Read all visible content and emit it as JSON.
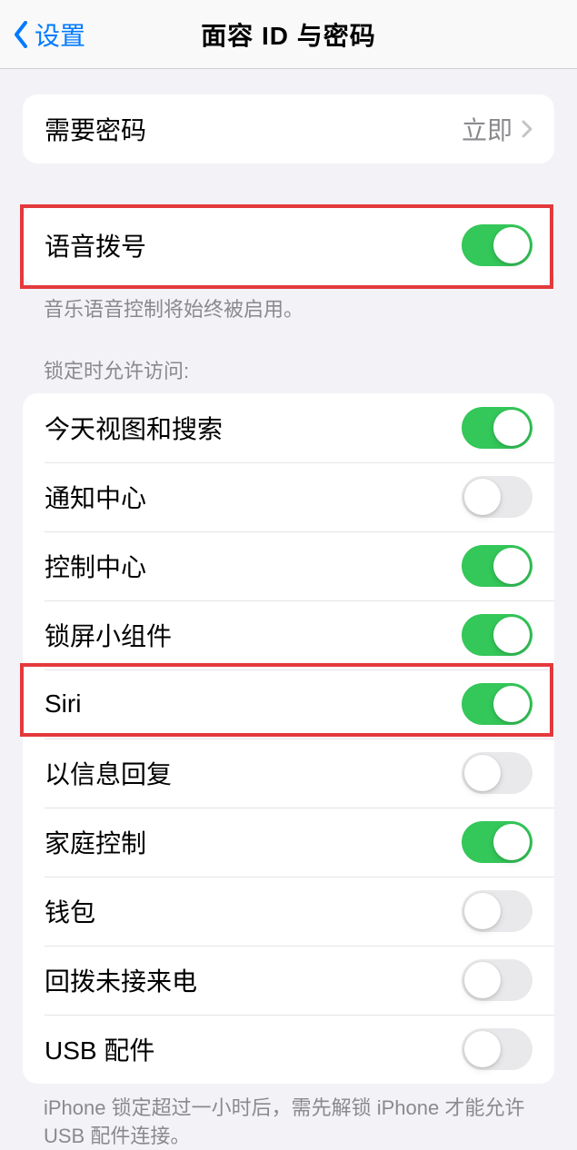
{
  "nav": {
    "back_label": "设置",
    "title": "面容 ID 与密码"
  },
  "require_passcode": {
    "label": "需要密码",
    "value": "立即"
  },
  "voice_dial": {
    "label": "语音拨号",
    "on": true,
    "footer": "音乐语音控制将始终被启用。"
  },
  "lock_access_header": "锁定时允许访问:",
  "lock_access": [
    {
      "label": "今天视图和搜索",
      "on": true
    },
    {
      "label": "通知中心",
      "on": false
    },
    {
      "label": "控制中心",
      "on": true
    },
    {
      "label": "锁屏小组件",
      "on": true
    },
    {
      "label": "Siri",
      "on": true
    },
    {
      "label": "以信息回复",
      "on": false
    },
    {
      "label": "家庭控制",
      "on": true
    },
    {
      "label": "钱包",
      "on": false
    },
    {
      "label": "回拨未接来电",
      "on": false
    },
    {
      "label": "USB 配件",
      "on": false
    }
  ],
  "usb_footer": "iPhone 锁定超过一小时后，需先解锁 iPhone 才能允许 USB 配件连接。"
}
